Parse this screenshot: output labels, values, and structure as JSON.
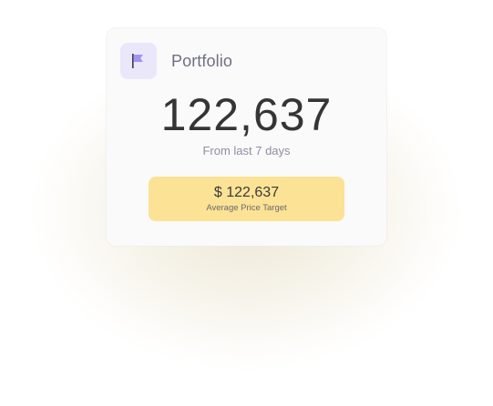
{
  "card": {
    "title": "Portfolio",
    "icon": "flag-icon",
    "main_value": "122,637",
    "subtitle": "From last 7 days"
  },
  "target": {
    "value": "$ 122,637",
    "label": "Average Price Target"
  },
  "colors": {
    "accent_purple": "#a394f0",
    "icon_background": "#ebe7fa",
    "target_background": "#fbe295",
    "card_background": "#fafafa"
  }
}
